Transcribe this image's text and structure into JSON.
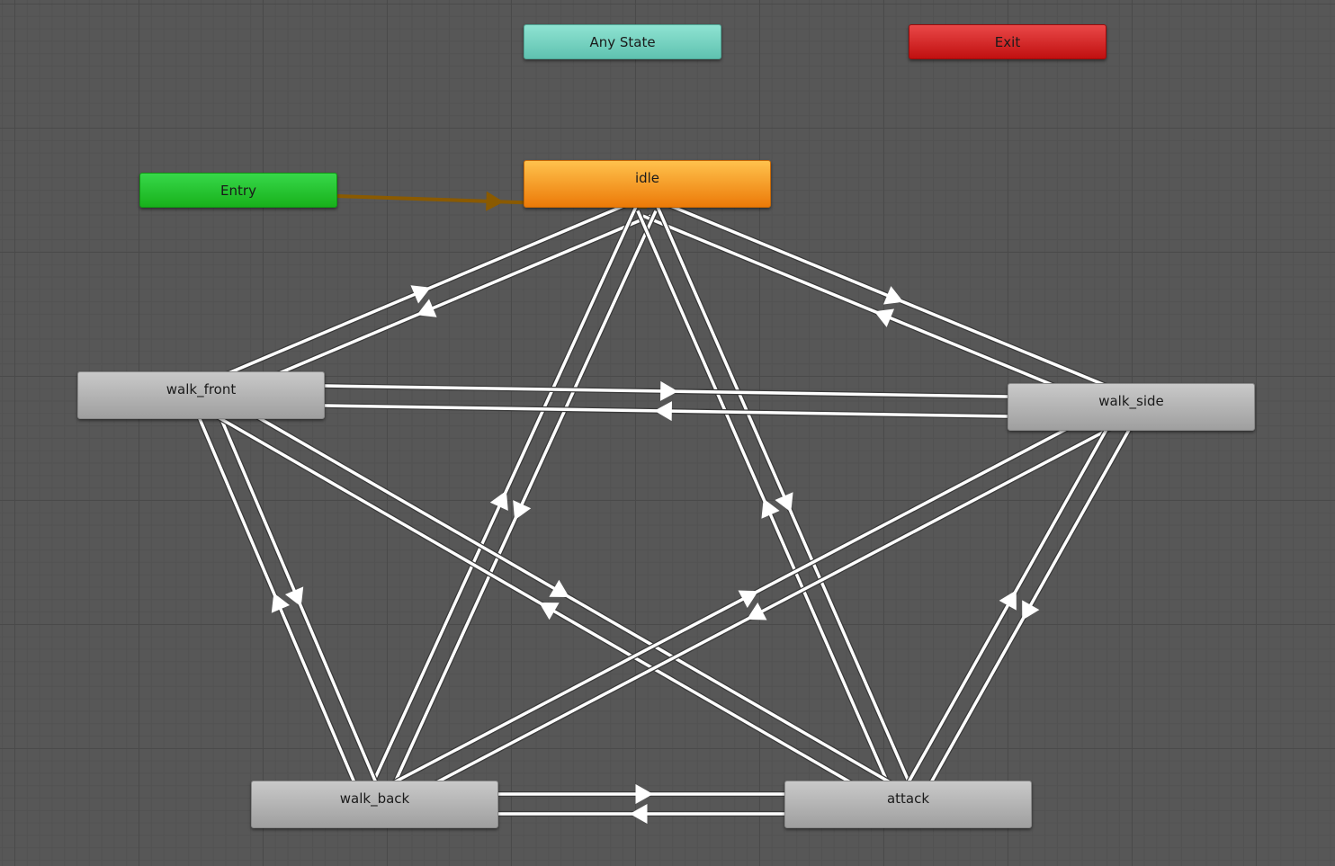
{
  "graph": {
    "nodes": {
      "any_state": {
        "label": "Any State",
        "type": "any"
      },
      "exit": {
        "label": "Exit",
        "type": "exit"
      },
      "entry": {
        "label": "Entry",
        "type": "entry"
      },
      "idle": {
        "label": "idle",
        "type": "default"
      },
      "walk_front": {
        "label": "walk_front",
        "type": "state"
      },
      "walk_side": {
        "label": "walk_side",
        "type": "state"
      },
      "walk_back": {
        "label": "walk_back",
        "type": "state"
      },
      "attack": {
        "label": "attack",
        "type": "state"
      }
    },
    "transitions": [
      {
        "from": "entry",
        "to": "idle",
        "kind": "default-entry"
      },
      {
        "from": "idle",
        "to": "walk_front"
      },
      {
        "from": "walk_front",
        "to": "idle"
      },
      {
        "from": "idle",
        "to": "walk_side"
      },
      {
        "from": "walk_side",
        "to": "idle"
      },
      {
        "from": "idle",
        "to": "walk_back"
      },
      {
        "from": "walk_back",
        "to": "idle"
      },
      {
        "from": "idle",
        "to": "attack"
      },
      {
        "from": "attack",
        "to": "idle"
      },
      {
        "from": "walk_front",
        "to": "walk_side"
      },
      {
        "from": "walk_side",
        "to": "walk_front"
      },
      {
        "from": "walk_front",
        "to": "walk_back"
      },
      {
        "from": "walk_back",
        "to": "walk_front"
      },
      {
        "from": "walk_front",
        "to": "attack"
      },
      {
        "from": "attack",
        "to": "walk_front"
      },
      {
        "from": "walk_side",
        "to": "walk_back"
      },
      {
        "from": "walk_back",
        "to": "walk_side"
      },
      {
        "from": "walk_side",
        "to": "attack"
      },
      {
        "from": "attack",
        "to": "walk_side"
      },
      {
        "from": "walk_back",
        "to": "attack"
      },
      {
        "from": "attack",
        "to": "walk_back"
      }
    ]
  },
  "colors": {
    "transition": "#ffffff",
    "transition_outline": "#3a3a3a",
    "entry_transition": "#8a5a00"
  }
}
